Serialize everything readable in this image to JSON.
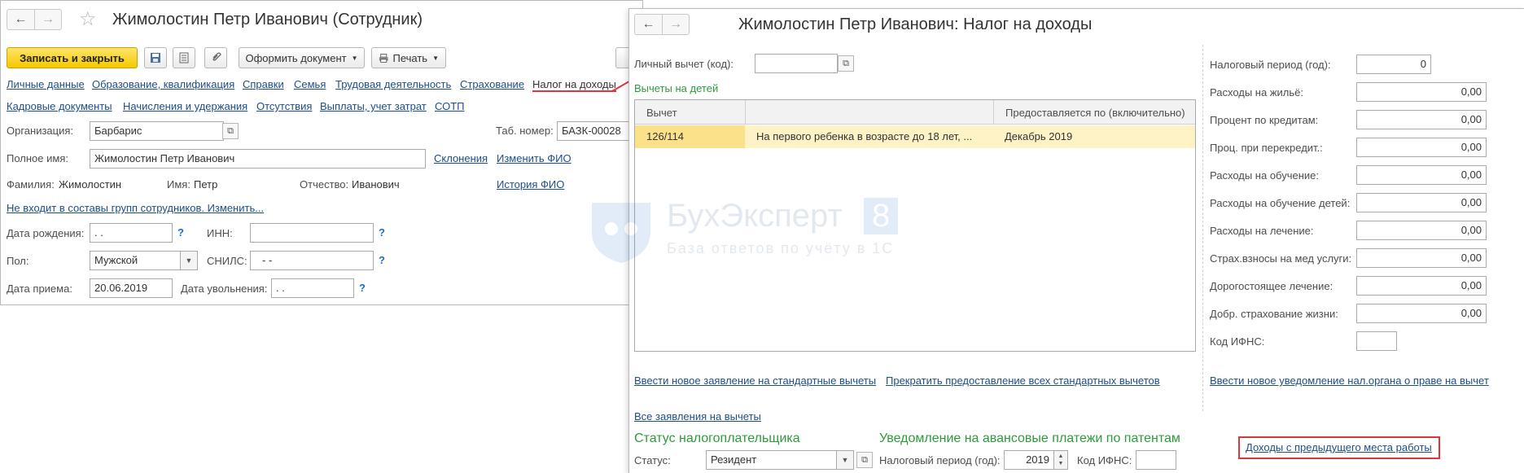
{
  "employee_window": {
    "title": "Жимолостин Петр Иванович (Сотрудник)",
    "toolbar": {
      "save_close": "Записать и закрыть",
      "create_doc": "Оформить документ",
      "print": "Печать"
    },
    "nav_links_row1": [
      "Личные данные",
      "Образование, квалификация",
      "Справки",
      "Семья",
      "Трудовая деятельность",
      "Страхование",
      "Налог на доходы"
    ],
    "nav_links_row2": [
      "Кадровые документы",
      "Начисления и удержания",
      "Отсутствия",
      "Выплаты, учет затрат",
      "СОТП"
    ],
    "organization": {
      "label": "Организация:",
      "value": "Барбарис"
    },
    "tab_number": {
      "label": "Таб. номер:",
      "value": "БАЗК-00028"
    },
    "full_name": {
      "label": "Полное имя:",
      "value": "Жимолостин Петр Иванович"
    },
    "declensions_link": "Склонения",
    "change_name_link": "Изменить ФИО",
    "surname": {
      "label": "Фамилия:",
      "value": "Жимолостин"
    },
    "first_name": {
      "label": "Имя:",
      "value": "Петр"
    },
    "patronymic": {
      "label": "Отчество:",
      "value": "Иванович"
    },
    "name_history_link": "История ФИО",
    "groups_link": "Не входит в составы групп сотрудников. Изменить...",
    "birth_date": {
      "label": "Дата рождения:",
      "value": " .  ."
    },
    "inn": {
      "label": "ИНН:",
      "value": ""
    },
    "gender": {
      "label": "Пол:",
      "value": "Мужской"
    },
    "snils": {
      "label": "СНИЛС:",
      "value": "-   -"
    },
    "hire_date": {
      "label": "Дата приема:",
      "value": "20.06.2019"
    },
    "dismissal_date": {
      "label": "Дата увольнения:",
      "value": " .  ."
    },
    "help_mark": "?"
  },
  "tax_window": {
    "title": "Жимолостин Петр Иванович: Налог на доходы",
    "personal_deduction": {
      "label": "Личный вычет (код):",
      "value": ""
    },
    "children_section": "Вычеты на детей",
    "table": {
      "headers": [
        "Вычет",
        "",
        "Предоставляется по (включительно)"
      ],
      "rows": [
        {
          "code": "126/114",
          "description": "На первого ребенка в возрасте до 18 лет, ...",
          "until": "Декабрь 2019"
        }
      ]
    },
    "right_fields": [
      {
        "label": "Налоговый период (год):",
        "value": "0"
      },
      {
        "label": "Расходы на жильё:",
        "value": "0,00"
      },
      {
        "label": "Процент по кредитам:",
        "value": "0,00"
      },
      {
        "label": "Проц. при перекредит.:",
        "value": "0,00"
      },
      {
        "label": "Расходы на обучение:",
        "value": "0,00"
      },
      {
        "label": "Расходы на обучение детей:",
        "value": "0,00"
      },
      {
        "label": "Расходы на лечение:",
        "value": "0,00"
      },
      {
        "label": "Страх.взносы на мед услуги:",
        "value": "0,00"
      },
      {
        "label": "Дорогостоящее лечение:",
        "value": "0,00"
      },
      {
        "label": "Добр. страхование жизни:",
        "value": "0,00"
      },
      {
        "label": "Код ИФНС:",
        "value": ""
      }
    ],
    "new_application_link": "Ввести новое заявление на стандартные вычеты",
    "stop_all_link": "Прекратить предоставление всех стандартных вычетов",
    "new_notice_link": "Ввести новое уведомление нал.органа о праве на вычет",
    "all_applications_link": "Все заявления на вычеты",
    "status_section": "Статус налогоплательщика",
    "status": {
      "label": "Статус:",
      "value": "Резидент"
    },
    "patent_section": "Уведомление на авансовые платежи по патентам",
    "patent_period": {
      "label": "Налоговый период (год):",
      "value": "2019"
    },
    "patent_ifns": {
      "label": "Код ИФНС:",
      "value": ""
    },
    "prev_income_link": "Доходы с предыдущего места работы"
  },
  "watermark": {
    "brand": "БухЭксперт",
    "number": "8",
    "tagline": "База ответов по учёту в 1С"
  },
  "colors": {
    "accent_yellow": "#f5c800",
    "link_blue": "#1c4e8b",
    "section_green": "#2e9a3c",
    "highlight_red": "#d9363e",
    "row_highlight": "#fdf3c6"
  }
}
